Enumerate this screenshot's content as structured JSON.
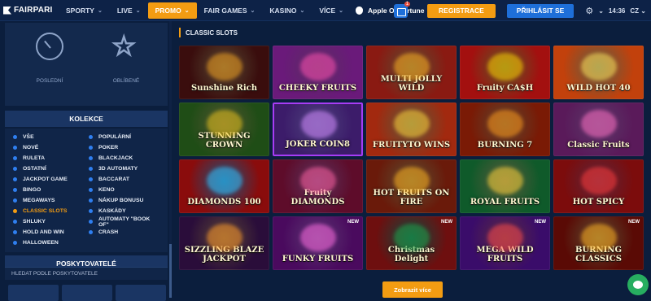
{
  "header": {
    "logo": "FAIRPARI",
    "nav": [
      {
        "label": "SPORTY",
        "active": false
      },
      {
        "label": "LIVE",
        "active": false
      },
      {
        "label": "PROMO",
        "active": true
      },
      {
        "label": "FAIR GAMES",
        "active": false
      },
      {
        "label": "KASINO",
        "active": false
      },
      {
        "label": "VÍCE",
        "active": false
      }
    ],
    "apple_label": "Apple Of Fortune",
    "gift_badge": "1",
    "register": "REGISTRACE",
    "login": "PŘIHLÁSIT SE",
    "time": "14:36",
    "language": "CZ"
  },
  "favorites": {
    "recent": "POSLEDNÍ",
    "favorite": "OBLÍBENÉ"
  },
  "collections": {
    "title": "KOLEKCE",
    "left": [
      "VŠE",
      "NOVÉ",
      "RULETA",
      "OSTATNÍ",
      "JACKPOT GAME",
      "BINGO",
      "MEGAWAYS",
      "CLASSIC SLOTS",
      "SHLUKY",
      "HOLD AND WIN",
      "HALLOWEEN"
    ],
    "right": [
      "POPULÁRNÍ",
      "POKER",
      "BLACKJACK",
      "3D AUTOMATY",
      "BACCARAT",
      "KENO",
      "NÁKUP BONUSU",
      "KASKÁDY",
      "AUTOMATY \"BOOK OF\"",
      "CRASH"
    ],
    "active": "CLASSIC SLOTS"
  },
  "providers": {
    "title": "POSKYTOVATELÉ",
    "search_label": "HLEDAT PODLE POSKYTOVATELE"
  },
  "main": {
    "section_title": "CLASSIC SLOTS",
    "more_button": "Zobrazit více",
    "games": [
      {
        "name": "Sunshine Rich",
        "bg": "#3a0d0d",
        "accent": "#f1a020",
        "new": false
      },
      {
        "name": "CHEEKY FRUITS",
        "bg": "#6a1a7a",
        "accent": "#ff4fb0",
        "new": false
      },
      {
        "name": "MULTI JOLLY WILD",
        "bg": "#8a1a12",
        "accent": "#ffb020",
        "new": false
      },
      {
        "name": "Fruity CA$H",
        "bg": "#a3100f",
        "accent": "#ffd000",
        "new": false
      },
      {
        "name": "WILD HOT 40",
        "bg": "#c2410c",
        "accent": "#ffe25a",
        "new": false
      },
      {
        "name": "STUNNING CROWN",
        "bg": "#1f4d16",
        "accent": "#e8c21c",
        "new": false
      },
      {
        "name": "JOKER COIN8",
        "bg": "#3c1c6a",
        "accent": "#d48bff",
        "new": false
      },
      {
        "name": "FRUITYTO WINS",
        "bg": "#a2290f",
        "accent": "#ffd33a",
        "new": false
      },
      {
        "name": "BURNING 7",
        "bg": "#7a1a05",
        "accent": "#ff9a1a",
        "new": false
      },
      {
        "name": "Classic Fruits",
        "bg": "#5a1a5a",
        "accent": "#ff6fc2",
        "new": false
      },
      {
        "name": "DIAMONDS 100",
        "bg": "#8a0c0c",
        "accent": "#35c3ff",
        "new": false
      },
      {
        "name": "Fruity DIAMONDS",
        "bg": "#5e0c2a",
        "accent": "#ff5fa0",
        "new": false
      },
      {
        "name": "HOT FRUITS ON FIRE",
        "bg": "#6a1a0a",
        "accent": "#ffb31f",
        "new": false
      },
      {
        "name": "ROYAL FRUITS",
        "bg": "#0f5a2a",
        "accent": "#ffd23a",
        "new": false
      },
      {
        "name": "HOT SPICY",
        "bg": "#7c0c0c",
        "accent": "#ff3a3a",
        "new": false
      },
      {
        "name": "SIZZLING BLAZE JACKPOT",
        "bg": "#2a0d3a",
        "accent": "#ff9a2a",
        "new": false
      },
      {
        "name": "FUNKY FRUITS",
        "bg": "#4a0a5e",
        "accent": "#ff6ae0",
        "new": true
      },
      {
        "name": "Christmas Delight",
        "bg": "#6e0f0f",
        "accent": "#1fa34a",
        "new": true
      },
      {
        "name": "MEGA WILD FRUITS",
        "bg": "#3a0c6a",
        "accent": "#ff4a4a",
        "new": true
      },
      {
        "name": "BURNING CLASSICS",
        "bg": "#5a0a05",
        "accent": "#ffb020",
        "new": true
      }
    ],
    "new_label": "NEW"
  },
  "colors": {
    "accent": "#f39c12",
    "primary": "#1e6fd9",
    "background": "#0b1e3d"
  }
}
